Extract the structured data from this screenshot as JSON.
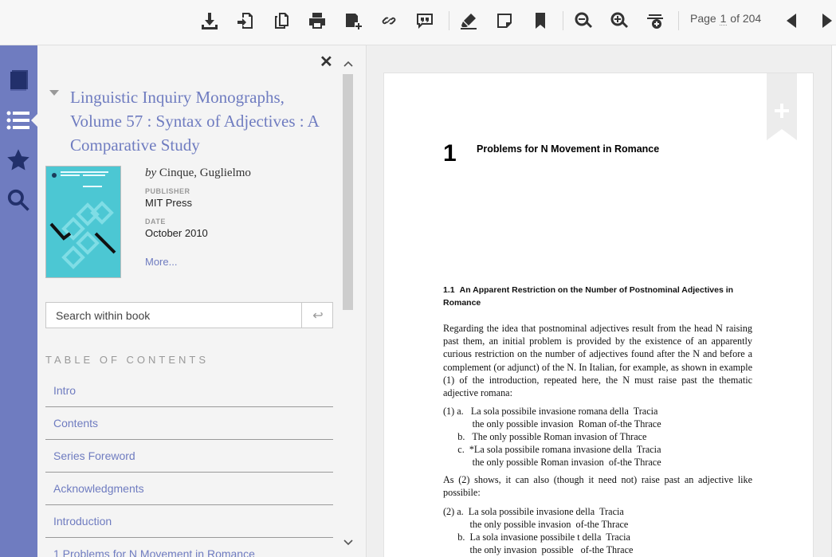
{
  "toolbar": {
    "icons": [
      "download-icon",
      "export-icon",
      "copy-icon",
      "print-icon",
      "add-to-folder-icon",
      "link-icon",
      "cite-icon",
      "highlight-icon",
      "note-icon",
      "bookmark-icon",
      "zoom-out-icon",
      "zoom-in-icon",
      "fit-page-icon"
    ],
    "page_label_prefix": "Page",
    "page_current": "1",
    "page_label_suffix": "of 204"
  },
  "rail": {
    "items": [
      "book-icon",
      "contents-list-icon",
      "favorites-star-icon",
      "search-icon"
    ],
    "active": "contents-list-icon",
    "color": "#6f7cc0"
  },
  "panel": {
    "close_label": "✕",
    "title": "Linguistic Inquiry Monographs, Volume 57 : Syntax of Adjectives : A Comparative Study",
    "by_prefix": "by",
    "author": "Cinque, Guglielmo",
    "publisher_label": "PUBLISHER",
    "publisher": "MIT Press",
    "date_label": "DATE",
    "date": "October 2010",
    "more_label": "More...",
    "search_placeholder": "Search within book",
    "search_go": "↩",
    "toc_heading": "TABLE OF CONTENTS",
    "toc": [
      "Intro",
      "Contents",
      "Series Foreword",
      "Acknowledgments",
      "Introduction",
      "1 Problems for N Movement in Romance"
    ]
  },
  "document": {
    "chapter_number": "1",
    "chapter_title": "Problems for N Movement in Romance",
    "section_number": "1.1",
    "section_title": "An Apparent Restriction on the Number of Postnominal Adjectives in Romance",
    "paragraph1": "Regarding the idea that postnominal adjectives result from the head N raising past them, an initial problem is provided by the existence of an apparently curious restriction on the number of adjectives found after the N and before a complement (or adjunct) of the N. In Italian, for example, as shown in example (1) of the introduction, repeated here, the N must raise past the thematic adjective romana:",
    "example1": [
      "(1) a.   La sola possibile invasione romana della  Tracia",
      "            the only possible invasion  Roman of-the Thrace",
      "      b.   The only possible Roman invasion of Thrace",
      "      c.  *La sola possibile romana invasione della  Tracia",
      "            the only possible Roman invasion  of-the Thrace"
    ],
    "paragraph2": "As (2) shows, it can also (though it need not) raise past an adjective like possibile:",
    "example2": [
      "(2) a.  La sola possibile invasione della  Tracia",
      "           the only possible invasion  of-the Thrace",
      "      b.  La sola invasione possibile t della  Tracia",
      "           the only invasion  possible   of-the Thrace"
    ]
  }
}
